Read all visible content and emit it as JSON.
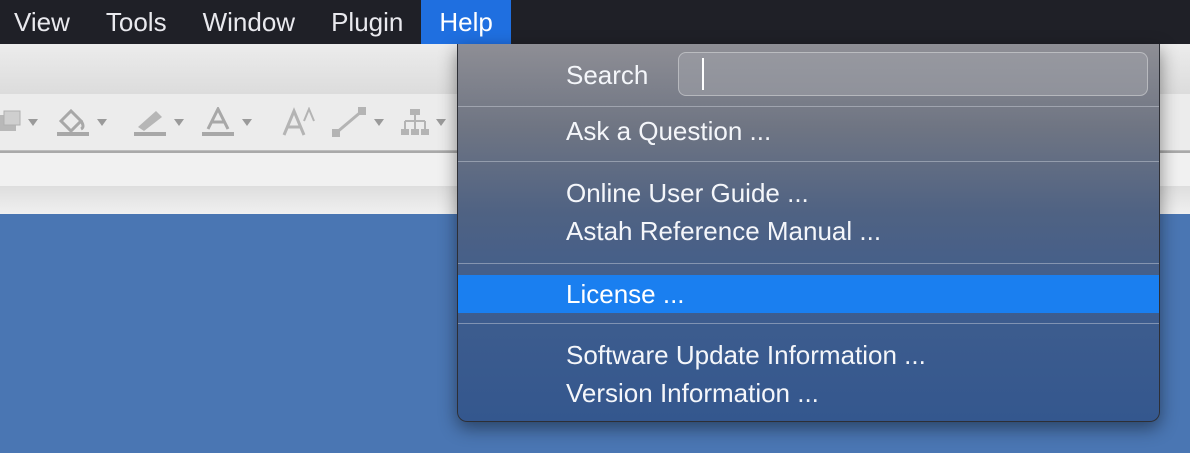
{
  "menubar": {
    "items": [
      {
        "label": "View"
      },
      {
        "label": "Tools"
      },
      {
        "label": "Window"
      },
      {
        "label": "Plugin"
      },
      {
        "label": "Help",
        "active": true
      }
    ]
  },
  "toolbar": {
    "icons": [
      "shape-fill-icon",
      "paint-bucket-icon",
      "line-color-icon",
      "font-color-icon",
      "font-size-icon",
      "connector-icon",
      "tree-layout-icon"
    ]
  },
  "help_menu": {
    "search": {
      "label": "Search",
      "value": ""
    },
    "items": [
      {
        "label": "Ask a Question ..."
      },
      {
        "label": "Online User Guide ..."
      },
      {
        "label": "Astah Reference Manual ..."
      },
      {
        "label": "License ...",
        "highlighted": true
      },
      {
        "label": "Software Update Information ..."
      },
      {
        "label": "Version Information ..."
      }
    ]
  },
  "colors": {
    "menubar_bg": "#1f2027",
    "accent": "#1a7ff0",
    "canvas_bg": "#4a76b3"
  }
}
